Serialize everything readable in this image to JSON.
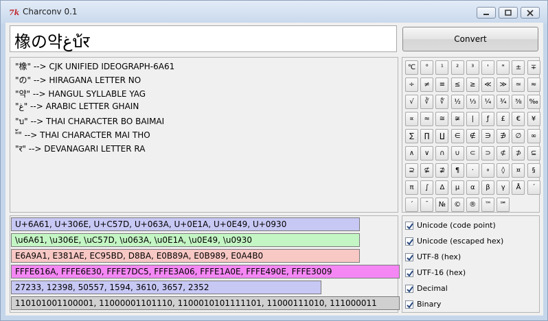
{
  "window": {
    "title": "Charconv 0.1",
    "app_icon": "tk-feather-icon"
  },
  "input": {
    "value": "橡の약غบ้र"
  },
  "convert_button": {
    "label": "Convert"
  },
  "names": [
    "\"橡\" --> CJK UNIFIED IDEOGRAPH-6A61",
    "\"の\" --> HIRAGANA LETTER NO",
    "\"약\" --> HANGUL SYLLABLE YAG",
    "\"غ\" --> ARABIC LETTER GHAIN",
    "\"บ\" --> THAI CHARACTER BO BAIMAI",
    "\"้\" --> THAI CHARACTER MAI THO",
    "\"र\" --> DEVANAGARI LETTER RA"
  ],
  "symbols": [
    [
      "℃",
      "°",
      "¹",
      "²",
      "³",
      "'",
      "\"",
      "±",
      "∓"
    ],
    [
      "÷",
      "≠",
      "≡",
      "≤",
      "≥",
      "≪",
      "≫",
      "≃",
      "≈"
    ],
    [
      "√",
      "∛",
      "∜",
      "½",
      "⅓",
      "¼",
      "¾",
      "⅜",
      "‰"
    ],
    [
      "∝",
      "≈",
      "≅",
      "≆",
      "|",
      "ƒ",
      "£",
      "€",
      "¥"
    ],
    [
      "∑",
      "∏",
      "∐",
      "∈",
      "∉",
      "∋",
      "∌",
      "∅",
      "∞"
    ],
    [
      "∧",
      "∨",
      "∩",
      "∪",
      "⊂",
      "⊃",
      "⊄",
      "⊅",
      "⊆"
    ],
    [
      "⊇",
      "⊈",
      "⊉",
      "¶",
      "·",
      "∘",
      "◊",
      "¤",
      "§"
    ],
    [
      "π",
      "∫",
      "Δ",
      "µ",
      "α",
      "β",
      "γ",
      "Å",
      "´"
    ],
    [
      "ˊ",
      "ˉ",
      "№",
      "©",
      "®",
      "™",
      "℠"
    ]
  ],
  "codes": [
    {
      "text": "U+6A61, U+306E, U+C57D, U+063A, U+0E1A, U+0E49, U+0930",
      "color": "#c8c8f5"
    },
    {
      "text": "\\u6A61, \\u306E, \\uC57D, \\u063A, \\u0E1A, \\u0E49, \\u0930",
      "color": "#c4f5c4"
    },
    {
      "text": "E6A9A1, E381AE, EC95BD, D8BA, E0B89A, E0B989, E0A4B0",
      "color": "#f8c8c4"
    },
    {
      "text": "FFFE616A, FFFE6E30, FFFE7DC5, FFFE3A06, FFFE1A0E, FFFE490E, FFFE3009",
      "color": "#f487f4"
    },
    {
      "text": "27233, 12398, 50557, 1594, 3610, 3657, 2352",
      "color": "#c8c8f5"
    },
    {
      "text": "110101001100001, 11000001101110, 1100010101111101, 11000111010, 111000011",
      "color": "#d0d0d0"
    }
  ],
  "options": [
    {
      "label": "Unicode (code point)",
      "checked": true
    },
    {
      "label": "Unicode (escaped hex)",
      "checked": true
    },
    {
      "label": "UTF-8 (hex)",
      "checked": true
    },
    {
      "label": "UTF-16 (hex)",
      "checked": true
    },
    {
      "label": "Decimal",
      "checked": true
    },
    {
      "label": "Binary",
      "checked": true
    }
  ]
}
